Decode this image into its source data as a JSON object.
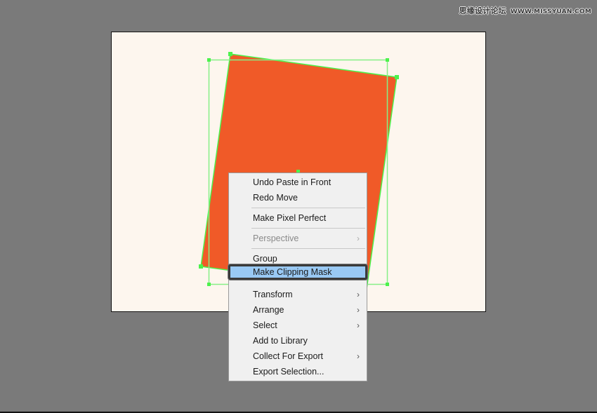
{
  "watermark": {
    "site_name": "思缘设计论坛",
    "url": "WWW.MISSYUAN.COM"
  },
  "canvas": {
    "artboard_color": "#fdf6ee",
    "background_color": "#7a7a7a",
    "shape_fill": "#f05a28",
    "selection_color": "#4cf24c"
  },
  "context_menu": {
    "items": [
      {
        "label": "Undo Paste in Front",
        "enabled": true,
        "submenu": false
      },
      {
        "label": "Redo Move",
        "enabled": true,
        "submenu": false
      },
      {
        "label": "Make Pixel Perfect",
        "enabled": true,
        "submenu": false
      },
      {
        "label": "Perspective",
        "enabled": false,
        "submenu": true
      },
      {
        "label": "Group",
        "enabled": true,
        "submenu": false
      },
      {
        "label": "Make Clipping Mask",
        "enabled": true,
        "submenu": false,
        "highlighted": true
      },
      {
        "label": "Transform",
        "enabled": true,
        "submenu": true
      },
      {
        "label": "Arrange",
        "enabled": true,
        "submenu": true
      },
      {
        "label": "Select",
        "enabled": true,
        "submenu": true
      },
      {
        "label": "Add to Library",
        "enabled": true,
        "submenu": false
      },
      {
        "label": "Collect For Export",
        "enabled": true,
        "submenu": true
      },
      {
        "label": "Export Selection...",
        "enabled": true,
        "submenu": false
      }
    ],
    "submenu_glyph": "›"
  }
}
